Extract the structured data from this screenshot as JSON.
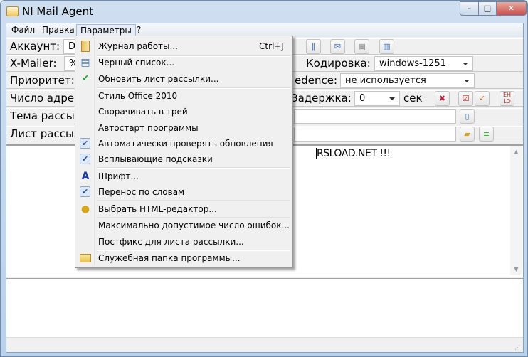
{
  "window": {
    "title": "NI Mail Agent",
    "minimize": "–",
    "maximize": "□",
    "close": "✕"
  },
  "menubar": [
    "Файл",
    "Правка",
    "Параметры",
    "?"
  ],
  "form": {
    "account_label": "Аккаунт:",
    "account_value": "De",
    "xmailer_label": "X-Mailer:",
    "xmailer_value": "%",
    "encoding_label": "Кодировка:",
    "encoding_value": "windows-1251",
    "priority_label": "Приоритет:",
    "precedence_label": "edence:",
    "precedence_value": "не используется",
    "count_label": "Число адре",
    "delay_label": "Задержка:",
    "delay_value": "0",
    "delay_unit": "сек",
    "subject_label": "Тема рассыл",
    "list_label": "Лист рассыл",
    "ehlo": "EH LO"
  },
  "editor": {
    "text": "RSLOAD.NET !!!",
    "scroll_up": "▲",
    "scroll_down": "▼"
  },
  "menu": {
    "items": [
      {
        "label": "Журнал работы...",
        "shortcut": "Ctrl+J",
        "icon": "journal-icon"
      },
      {
        "label": "Черный список...",
        "icon": "document-icon"
      },
      {
        "label": "Обновить лист рассылки...",
        "icon": "update-list-icon"
      },
      {
        "label": "Стиль Office 2010"
      },
      {
        "label": "Сворачивать в трей"
      },
      {
        "label": "Автостарт программы"
      },
      {
        "label": "Автоматически проверять обновления",
        "checked": true
      },
      {
        "label": "Всплывающие подсказки",
        "checked": true
      },
      {
        "label": "Шрифт...",
        "icon": "font-icon"
      },
      {
        "label": "Перенос по словам",
        "checked": true
      },
      {
        "label": "Выбрать HTML-редактор...",
        "icon": "html-editor-icon"
      },
      {
        "label": "Максимально допустимое число ошибок..."
      },
      {
        "label": "Постфикс для листа рассылки..."
      },
      {
        "label": "Служебная папка программы...",
        "icon": "folder-icon"
      }
    ],
    "check_glyph": "✔"
  }
}
